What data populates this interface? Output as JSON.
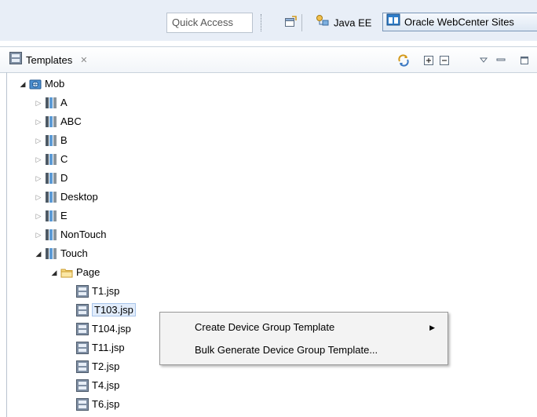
{
  "toolbar": {
    "quick_access": "Quick Access",
    "perspectives": [
      {
        "label": "Java EE",
        "icon": "java-ee-perspective-icon"
      },
      {
        "label": "Oracle WebCenter Sites",
        "icon": "webcenter-sites-perspective-icon"
      }
    ]
  },
  "view": {
    "tab_label": "Templates",
    "tab_close": "✕"
  },
  "tree": {
    "root": "Mob",
    "groups": [
      "A",
      "ABC",
      "B",
      "C",
      "D",
      "Desktop",
      "E",
      "NonTouch",
      "Touch"
    ],
    "folder": "Page",
    "files": [
      "T1.jsp",
      "T103.jsp",
      "T104.jsp",
      "T11.jsp",
      "T2.jsp",
      "T4.jsp",
      "T6.jsp"
    ],
    "selected_file": "T103.jsp"
  },
  "context_menu": {
    "items": [
      {
        "label": "Create Device Group Template",
        "submenu": "▶"
      },
      {
        "label": "Bulk Generate Device Group Template..."
      }
    ]
  },
  "colors": {
    "toolbar_bg": "#e8eef7",
    "selection_bg": "#e1ecfb",
    "menu_bg": "#f3f3f3"
  }
}
